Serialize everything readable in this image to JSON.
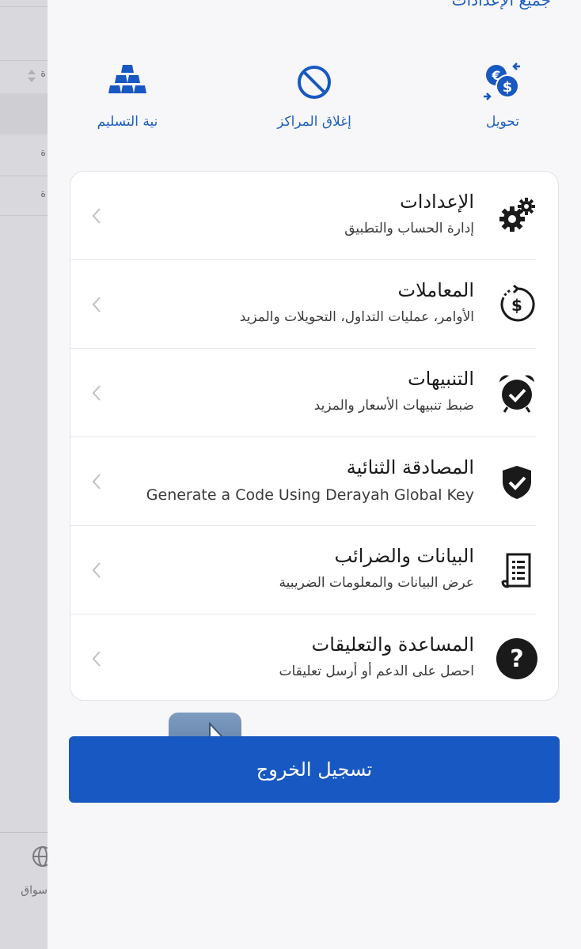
{
  "background": {
    "column_label_fragment": "ة",
    "row1_fragment": "ة",
    "row2_fragment": "ة",
    "markets_label_fragment": "سواق"
  },
  "drawer": {
    "top_link": "جميع الإعدادات",
    "quick_actions": [
      {
        "label": "تحويل",
        "icon": "currency-exchange-icon"
      },
      {
        "label": "إغلاق المراكز",
        "icon": "block-icon"
      },
      {
        "label": "نية التسليم",
        "icon": "gold-bars-icon"
      }
    ],
    "menu": [
      {
        "title": "الإعدادات",
        "subtitle": "إدارة الحساب والتطبيق",
        "icon": "gears-icon"
      },
      {
        "title": "المعاملات",
        "subtitle": "الأوامر، عمليات التداول، التحويلات والمزيد",
        "icon": "transaction-history-icon"
      },
      {
        "title": "التنبيهات",
        "subtitle": "ضبط تنبيهات الأسعار والمزيد",
        "icon": "alarm-clock-icon"
      },
      {
        "title": "المصادقة الثنائية",
        "subtitle": "Generate a Code Using Derayah Global Key",
        "icon": "shield-check-icon"
      },
      {
        "title": "البيانات والضرائب",
        "subtitle": "عرض البيانات والمعلومات الضريبية",
        "icon": "document-icon"
      },
      {
        "title": "المساعدة والتعليقات",
        "subtitle": "احصل على الدعم أو أرسل تعليقات",
        "icon": "help-icon"
      }
    ],
    "logout_label": "تسجيل الخروج"
  },
  "colors": {
    "accent": "#1858c2",
    "link": "#1f5fbf",
    "overlay_arrow": "#5a7aa3"
  }
}
